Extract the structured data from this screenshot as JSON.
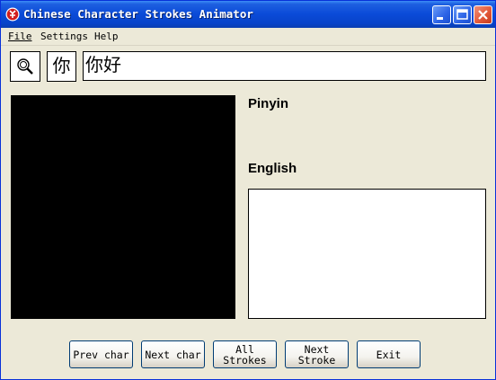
{
  "window": {
    "title": "Chinese Character Strokes Animator"
  },
  "menu": {
    "file": "File",
    "settings": "Settings",
    "help": "Help"
  },
  "search": {
    "current_char": "你",
    "word": "你好"
  },
  "info": {
    "pinyin_label": "Pinyin",
    "english_label": "English",
    "pinyin_value": "",
    "english_value": ""
  },
  "buttons": {
    "prev_char": "Prev char",
    "next_char": "Next char",
    "all_strokes": "All\nStrokes",
    "next_stroke": "Next\nStroke",
    "exit": "Exit"
  },
  "icons": {
    "app": "app-icon",
    "search": "magnifier-icon",
    "minimize": "minimize-icon",
    "maximize": "maximize-icon",
    "close": "close-icon"
  },
  "colors": {
    "titlebar": "#0a4ad8",
    "window_bg": "#ece9d8",
    "canvas": "#000000",
    "close": "#e35a3a"
  }
}
